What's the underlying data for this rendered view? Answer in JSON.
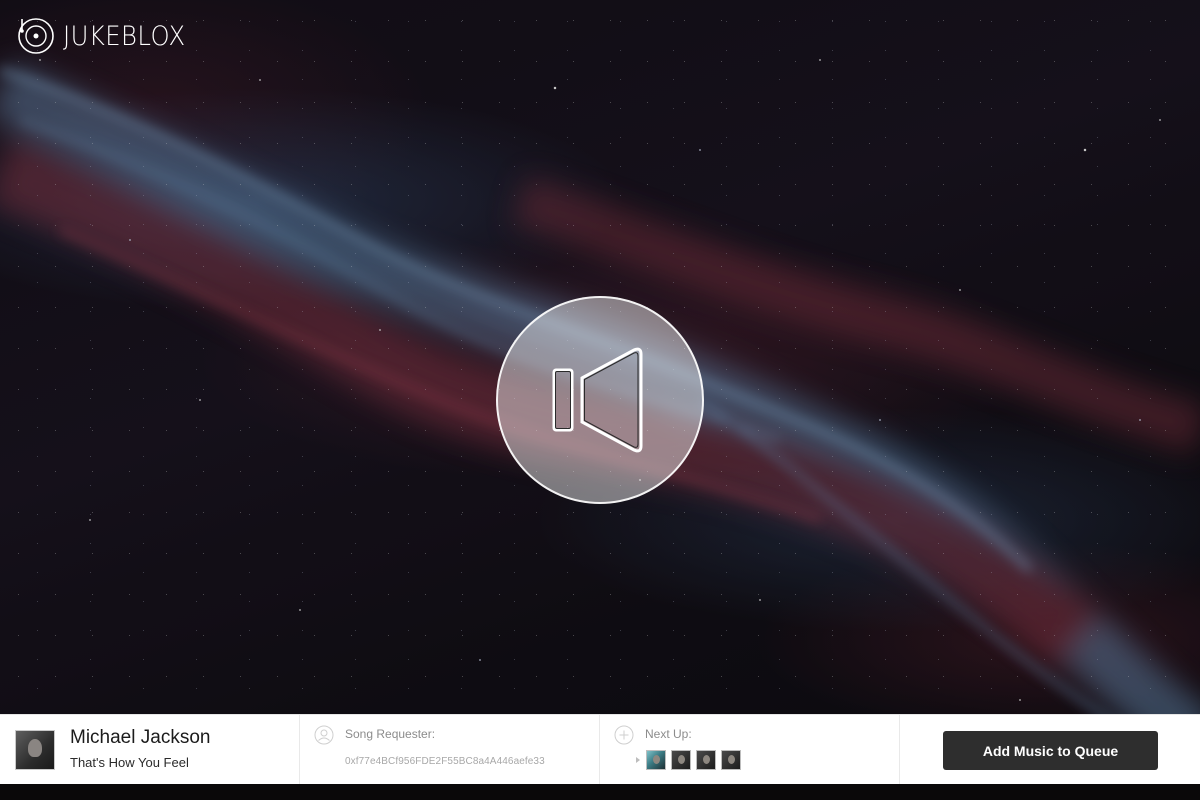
{
  "app": {
    "logo_text": "JUKEBLOX"
  },
  "center_control": {
    "icon": "speaker-muted-icon"
  },
  "now_playing": {
    "artist": "Michael Jackson",
    "song": "That's How You Feel"
  },
  "requester": {
    "label": "Song Requester:",
    "value": "0xf77e4BCf956FDE2F55BC8a4A446aefe33"
  },
  "next_up": {
    "label": "Next Up:",
    "thumbnails": 4
  },
  "actions": {
    "add_label": "Add Music to Queue"
  },
  "colors": {
    "button_bg": "#2e2e2e",
    "bar_bg": "#ffffff",
    "muted_text": "#8c8c8c"
  }
}
